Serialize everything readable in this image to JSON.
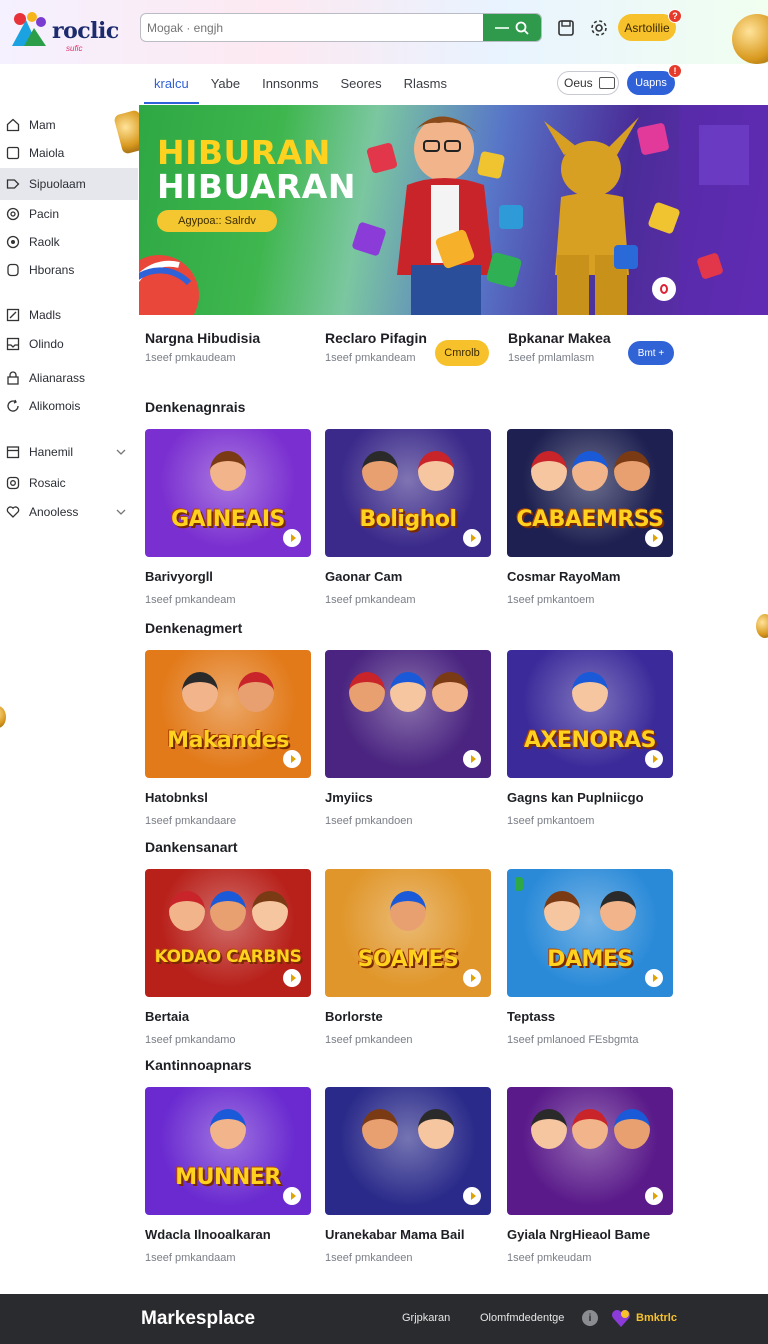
{
  "header": {
    "logo_text": "roclic",
    "logo_sub": "sufic",
    "search_placeholder": "Mogak · engjh",
    "account_label": "Asrtolilie",
    "account_badge": "?"
  },
  "tabs": [
    {
      "label": "kralcu",
      "active": true
    },
    {
      "label": "Yabe",
      "active": false
    },
    {
      "label": "Innsonms",
      "active": false
    },
    {
      "label": "Seores",
      "active": false
    },
    {
      "label": "Rlasms",
      "active": false
    }
  ],
  "toolbar": {
    "ops_label": "Oeus",
    "upgrade_label": "Uapns",
    "upgrade_badge": "!"
  },
  "sidebar": {
    "items": [
      {
        "label": "Mam",
        "icon": "home-icon"
      },
      {
        "label": "Maiola",
        "icon": "square-icon"
      },
      {
        "label": "Sipuolaam",
        "icon": "tag-icon",
        "active": true
      },
      {
        "label": "Pacin",
        "icon": "target-icon"
      },
      {
        "label": "Raolk",
        "icon": "radio-icon"
      },
      {
        "label": "Hborans",
        "icon": "box-icon"
      },
      {
        "label": "Madls",
        "icon": "edit-icon"
      },
      {
        "label": "Olindo",
        "icon": "inbox-icon"
      },
      {
        "label": "Alianarass",
        "icon": "lock-icon"
      },
      {
        "label": "Alikomois",
        "icon": "refresh-icon"
      },
      {
        "label": "Hanemil",
        "icon": "calendar-icon",
        "expandable": true
      },
      {
        "label": "Rosaic",
        "icon": "gear-icon"
      },
      {
        "label": "Anooless",
        "icon": "heart-icon",
        "expandable": true
      }
    ]
  },
  "hero": {
    "title_line1": "HIBURAN",
    "title_line2": "HIBUARAN",
    "pill_label": "Agypoa:: Salrdv"
  },
  "featured": [
    {
      "title": "Nargna Hibudisia",
      "sub": "1seef pmkaudeam"
    },
    {
      "title": "Reclaro Pifagin",
      "sub": "1seef pmkandeam",
      "button": "Cmrolb"
    },
    {
      "title": "Bpkanar Makea",
      "sub": "1seef pmlamlasm",
      "button": "Bmt +"
    }
  ],
  "sections": [
    {
      "title": "Denkenagnrais",
      "cards": [
        {
          "title": "Barivyorgll",
          "sub": "1seef pmkandeam",
          "art": "GAINEAIS",
          "bg": "#7a2fd0"
        },
        {
          "title": "Gaonar Cam",
          "sub": "1seef pmkandeam",
          "art": "Bolighol",
          "bg": "#3b2a8a"
        },
        {
          "title": "Cosmar RayoMam",
          "sub": "1seef pmkantoem",
          "art": "CABAEMRSS",
          "bg": "#1d2050"
        }
      ]
    },
    {
      "title": "Denkenagmert",
      "cards": [
        {
          "title": "Hatobnksl",
          "sub": "1seef pmkandaare",
          "art": "Makandes",
          "bg": "#e27a1a"
        },
        {
          "title": "Jmyiics",
          "sub": "1seef pmkandoen",
          "art": "",
          "bg": "#4a2480"
        },
        {
          "title": "Gagns kan Puplniicgo",
          "sub": "1seef pmkantoem",
          "art": "AXENORAS",
          "bg": "#3a2a9a"
        }
      ]
    },
    {
      "title": "Dankensanart",
      "cards": [
        {
          "title": "Bertaia",
          "sub": "1seef pmkandamo",
          "art": "KODAO CARBNS",
          "bg": "#b8201a"
        },
        {
          "title": "Borlorste",
          "sub": "1seef pmkandeen",
          "art": "SOAMES",
          "bg": "#e0962a"
        },
        {
          "title": "Teptass",
          "sub": "1seef pmlanoed FEsbgmta",
          "art": "DAMES",
          "bg": "#2a8ad8"
        }
      ]
    },
    {
      "title": "Kantinnoapnars",
      "cards": [
        {
          "title": "Wdacla Ilnooalkaran",
          "sub": "1seef pmkandaam",
          "art": "MUNNER",
          "bg": "#6a2ad0"
        },
        {
          "title": "Uranekabar Mama Bail",
          "sub": "1seef pmkandeen",
          "art": "",
          "bg": "#2a2a8a"
        },
        {
          "title": "Gyiala NrgHieaol Bame",
          "sub": "1seef pmkeudam",
          "art": "",
          "bg": "#5a1a8a"
        }
      ]
    }
  ],
  "footer": {
    "brand": "Markesplace",
    "link1": "Grjpkaran",
    "link2": "Olomfmdedentge",
    "info": "i",
    "logo_text": "Bmktrlc"
  },
  "colors": {
    "accent": "#2f61d8",
    "search_button": "#2f9a4c",
    "highlight": "#f6c12a",
    "footer_bg": "#2a2b2e"
  }
}
